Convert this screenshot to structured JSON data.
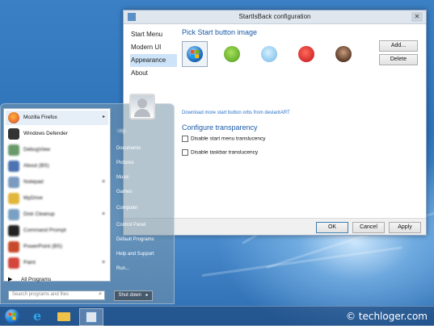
{
  "config_window": {
    "title": "StartIsBack configuration",
    "close_glyph": "✕",
    "nav": [
      "Start Menu",
      "Modern UI",
      "Appearance",
      "About"
    ],
    "selected_nav": "Appearance",
    "section_start_button": "Pick Start button image",
    "start_button_images": [
      "windows-orb-icon",
      "green-bird-icon",
      "blue-bird-icon",
      "red-bird-icon",
      "user-photo-icon"
    ],
    "add_label": "Add...",
    "delete_label": "Delete",
    "download_link": "Download more start button orbs from deviantART",
    "section_transparency": "Configure transparency",
    "options": [
      "Disable start menu translucency",
      "Disable taskbar translucency"
    ],
    "ok_label": "OK",
    "cancel_label": "Cancel",
    "apply_label": "Apply"
  },
  "start_menu": {
    "programs": [
      {
        "label": "Mozilla Firefox",
        "arrow": "▸",
        "color": "#e8742a"
      },
      {
        "label": "Windows Defender",
        "arrow": "",
        "color": "#333333"
      },
      {
        "label": "DebugView",
        "arrow": "",
        "color": "#6a9a6a"
      },
      {
        "label": "About (BS)",
        "arrow": "",
        "color": "#4d73b2"
      },
      {
        "label": "Notepad",
        "arrow": "▸",
        "color": "#7a9ac0"
      },
      {
        "label": "MyDrive",
        "arrow": "",
        "color": "#e2b63b"
      },
      {
        "label": "Disk Cleanup",
        "arrow": "▸",
        "color": "#7aa0c4"
      },
      {
        "label": "Command Prompt",
        "arrow": "",
        "color": "#222222"
      },
      {
        "label": "PowerPoint (BS)",
        "arrow": "",
        "color": "#c84a2a"
      },
      {
        "label": "Paint",
        "arrow": "▸",
        "color": "#d4453a"
      }
    ],
    "all_programs": "All Programs",
    "search_placeholder": "Search programs and files",
    "user_name": "Titty",
    "right_items": [
      "Documents",
      "Pictures",
      "Music",
      "Games",
      "Computer",
      "Control Panel",
      "Default Programs",
      "Help and Support",
      "Run..."
    ],
    "shutdown_label": "Shut down",
    "shutdown_arrow": "▸"
  },
  "watermark": "© techloger.com"
}
